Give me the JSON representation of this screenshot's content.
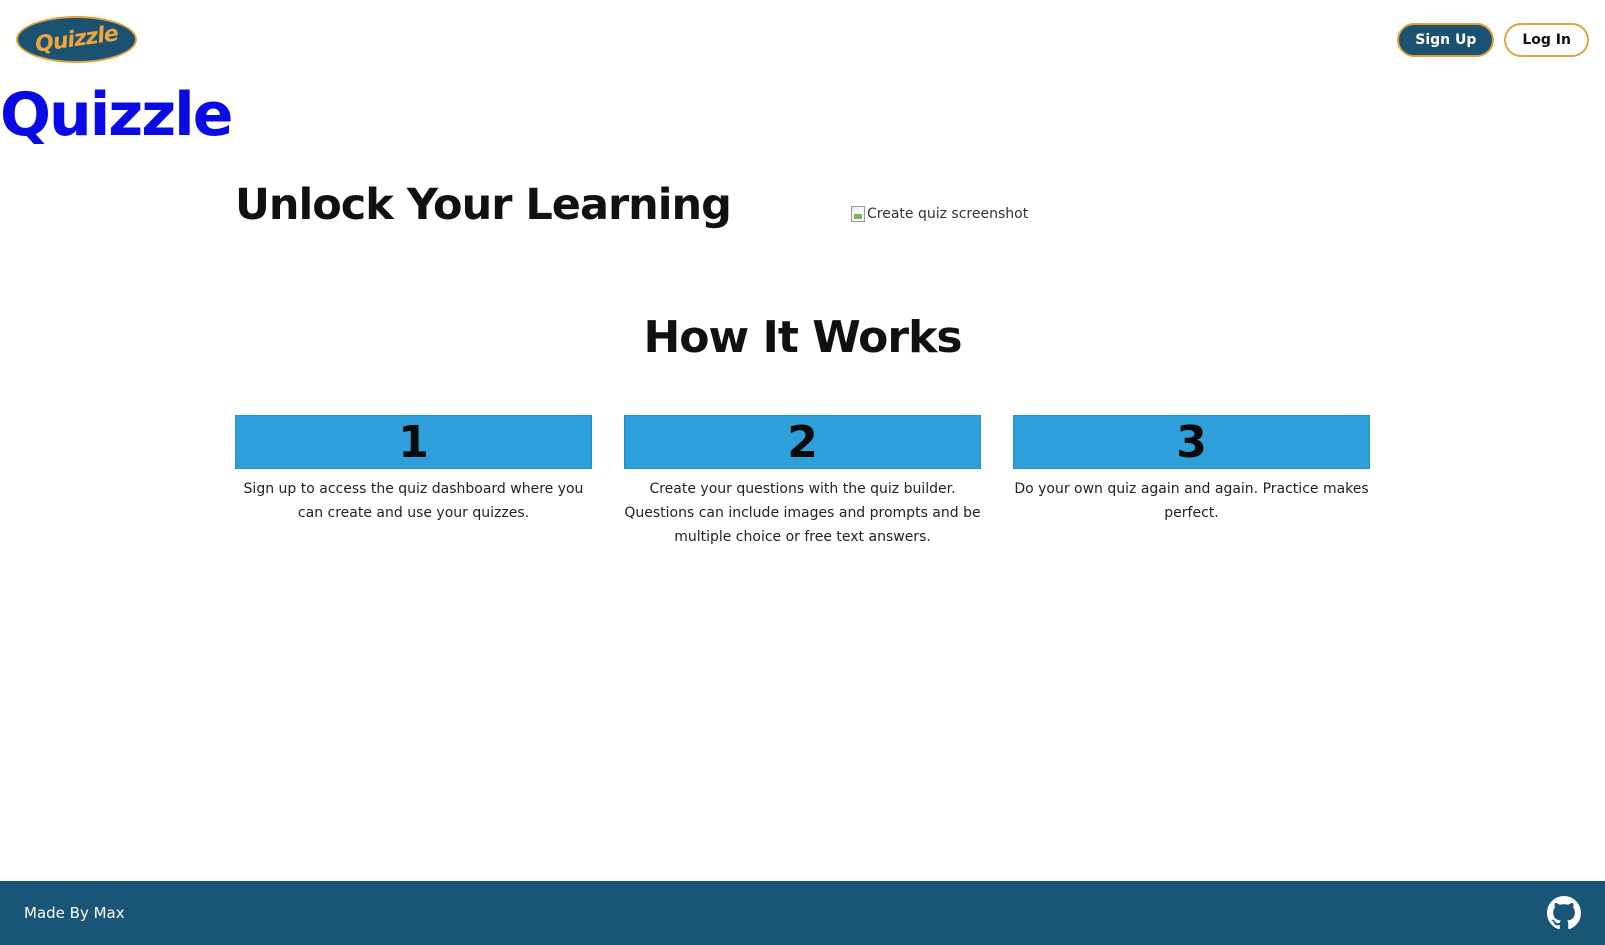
{
  "header": {
    "logo_text": "Quizzle",
    "signup_label": "Sign Up",
    "login_label": "Log In"
  },
  "site_title": "Quizzle",
  "hero": {
    "heading": "Unlock Your Learning",
    "image_alt": "Create quiz screenshot"
  },
  "how_it_works": {
    "heading": "How It Works",
    "steps": [
      {
        "number": "1",
        "text": "Sign up to access the quiz dashboard where you can create and use your quizzes."
      },
      {
        "number": "2",
        "text": "Create your questions with the quiz builder. Questions can include images and prompts and be multiple choice or free text answers."
      },
      {
        "number": "3",
        "text": "Do your own quiz again and again. Practice makes perfect."
      }
    ]
  },
  "footer": {
    "text": "Made By Max",
    "icon": "github-icon"
  },
  "colors": {
    "brand_dark": "#185576",
    "accent": "#e0a23c",
    "step_blue": "#2e9fda",
    "title_blue": "#0a0ae6"
  }
}
